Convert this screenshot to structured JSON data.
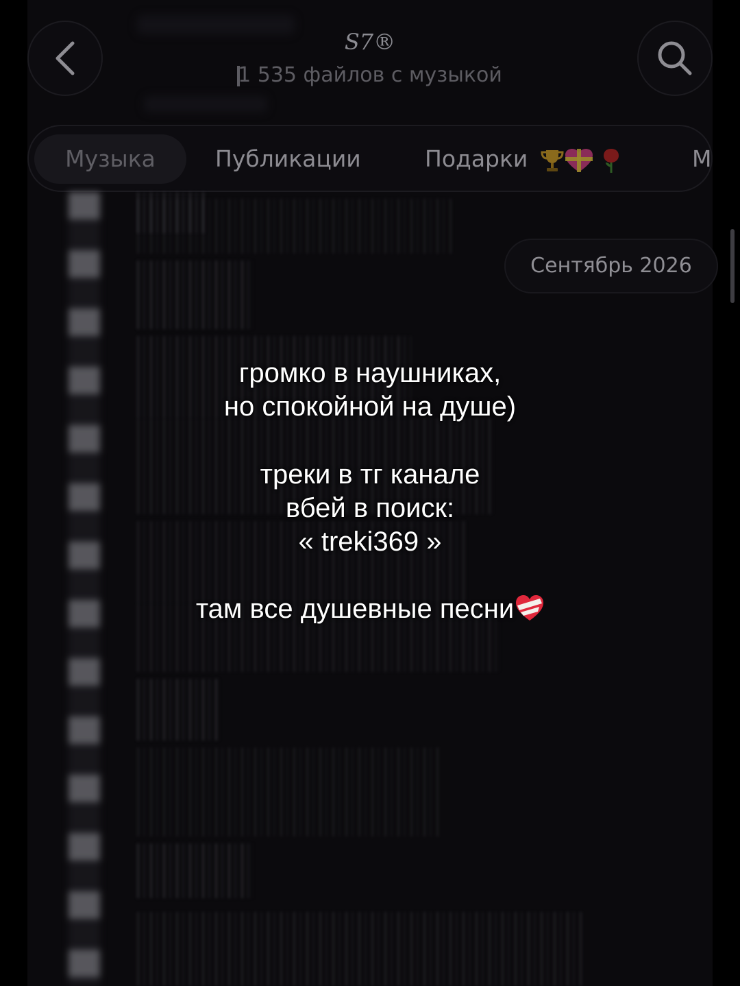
{
  "header": {
    "title": "S7®",
    "subtitle": "1 535 файлов с музыкой",
    "back_icon": "chevron-left-icon",
    "search_icon": "search-icon"
  },
  "tabs": [
    {
      "label": "Музыка",
      "active": true
    },
    {
      "label": "Публикации",
      "active": false
    },
    {
      "label": "Подарки",
      "active": false,
      "emojis": [
        "trophy-icon",
        "heart-gift-icon",
        "rose-icon"
      ]
    },
    {
      "label": "М",
      "active": false
    }
  ],
  "month_divider": "Сентябрь 2026",
  "caption": {
    "line1": "громко в наушниках,",
    "line2": "но спокойной на душе)",
    "line3": "треки в тг канале",
    "line4": "вбей в поиск:",
    "line5": "« treki369 »",
    "line6": "там все душевные песни"
  },
  "colors": {
    "background": "#000000",
    "panel": "#0b0a0d",
    "caption_text": "#ffffff",
    "muted_text": "#8d8c92"
  }
}
